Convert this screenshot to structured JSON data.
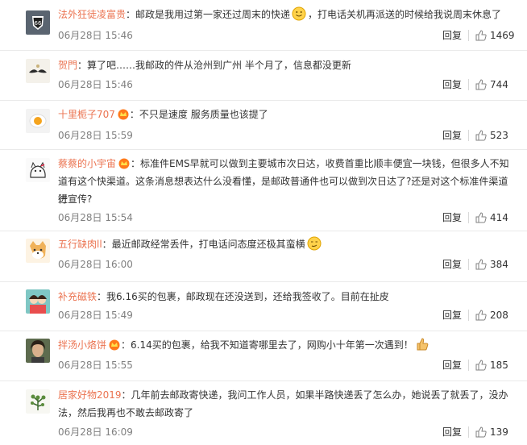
{
  "comments": [
    {
      "user": "法外狂徒凌富贵",
      "crown": false,
      "text": "：邮政是我用过第一家还过周末的快递",
      "emoji": "smile-emoji",
      "text2": "，打电话关机再派送的时候给我说周末休息了",
      "time": "06月28日 15:46",
      "reply": "回复",
      "likes": "1469",
      "avatar_icon": "route66-avatar-icon"
    },
    {
      "user": "贺門",
      "crown": false,
      "text": "：算了吧……我邮政的件从沧州到广州 半个月了，信息都没更新",
      "time": "06月28日 15:46",
      "reply": "回复",
      "likes": "744",
      "avatar_icon": "mustache-avatar-icon"
    },
    {
      "user": "十里栀子707",
      "crown": true,
      "text": "：不只是速度 服务质量也该提了",
      "time": "06月28日 15:59",
      "reply": "回复",
      "likes": "523",
      "avatar_icon": "egg-avatar-icon"
    },
    {
      "user": "蔡蔡的小宇宙",
      "crown": true,
      "text": "：标准件EMS早就可以做到主要城市次日达，收费首重比顺丰便宜一块钱，但很多人不知",
      "text_line2": "道有这个快渠道。这条消息想表达什么没看懂，是邮政普通件也可以做到次日达了?还是对这个标准件渠道进",
      "text_line3": "行宣传?",
      "time": "06月28日 15:54",
      "reply": "回复",
      "likes": "414",
      "avatar_icon": "cat-sketch-avatar-icon"
    },
    {
      "user": "五行缺肉ll",
      "crown": false,
      "text": "：最近邮政经常丢件，打电话问态度还极其蛮横",
      "emoji": "smirk-emoji",
      "time": "06月28日 16:00",
      "reply": "回复",
      "likes": "384",
      "avatar_icon": "shiba-avatar-icon"
    },
    {
      "user": "补充磁铁",
      "crown": false,
      "text": "：我6.16买的包裹，邮政现在还没送到，还给我签收了。目前在扯皮",
      "time": "06月28日 15:49",
      "reply": "回复",
      "likes": "208",
      "avatar_icon": "couple-avatar-icon"
    },
    {
      "user": "拌汤小烙饼",
      "crown": true,
      "text": "：6.14买的包裹，给我不知道寄哪里去了，网购小十年第一次遇到！",
      "emoji": "thumb-emoji",
      "time": "06月28日 15:55",
      "reply": "回复",
      "likes": "185",
      "avatar_icon": "portrait-avatar-icon"
    },
    {
      "user": "居家好物2019",
      "crown": false,
      "text": "：几年前去邮政寄快递，我问工作人员，如果半路快递丢了怎么办，她说丢了就丢了，没办",
      "text_line2": "法，然后我再也不敢去邮政寄了",
      "time": "06月28日 16:09",
      "reply": "回复",
      "likes": "139",
      "avatar_icon": "plant-avatar-icon"
    }
  ]
}
